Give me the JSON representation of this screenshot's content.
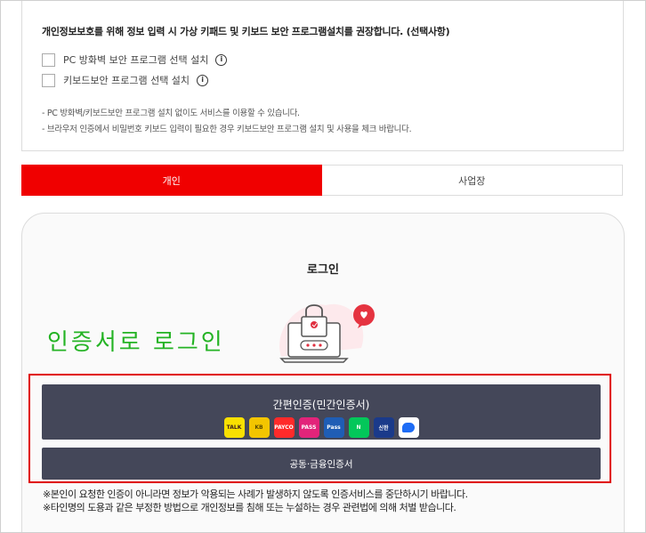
{
  "security": {
    "title": "개인정보보호를 위해 정보 입력 시 가상 키패드 및 키보드 보안 프로그램설치를 권장합니다. (선택사항)",
    "option1": "PC 방화벽 보안 프로그램 선택 설치",
    "option2": "키보드보안 프로그램 선택 설치",
    "info_glyph": "i",
    "note1": "- PC 방화벽/키보드보안 프로그램 설치 없이도 서비스를 이용할 수 있습니다.",
    "note2": "- 브라우저 인증에서 비밀번호 키보드 입력이 필요한 경우 키보드보안 프로그램 설치 및 사용을 체크 바랍니다."
  },
  "tabs": {
    "personal": "개인",
    "business": "사업장"
  },
  "login": {
    "title": "로그인",
    "annotation": "인증서로 로그인",
    "easy_auth_label": "간편인증(민간인증서)",
    "cert_label": "공동·금융인증서"
  },
  "providers": [
    {
      "name": "kakaotalk-icon",
      "text": "TALK",
      "bg": "#f9e000",
      "fg": "#3a1d1d"
    },
    {
      "name": "kb-icon",
      "text": "KB",
      "bg": "#f3c500",
      "fg": "#5b4a00"
    },
    {
      "name": "payco-icon",
      "text": "PAYCO",
      "bg": "#ff2a2a",
      "fg": "#ffffff"
    },
    {
      "name": "pass-icon",
      "text": "PASS",
      "bg": "#e2247a",
      "fg": "#ffffff"
    },
    {
      "name": "samsung-pass-icon",
      "text": "Pass",
      "bg": "#1f5db5",
      "fg": "#ffffff"
    },
    {
      "name": "naver-icon",
      "text": "N",
      "bg": "#03c75a",
      "fg": "#ffffff"
    },
    {
      "name": "shinhan-icon",
      "text": "신한",
      "bg": "#1a3a8a",
      "fg": "#ffffff"
    },
    {
      "name": "toss-icon",
      "text": "",
      "bg": "#ffffff",
      "fg": "#1e6cf5"
    }
  ],
  "disclaimers": {
    "line1": "※본인이 요청한 인증이 아니라면 정보가 악용되는 사례가 발생하지 않도록 인증서비스를 중단하시기 바랍니다.",
    "line2": "※타인명의 도용과 같은 부정한 방법으로 개인정보를 침해 또는 누설하는 경우 관련법에 의해 처벌 받습니다."
  },
  "colors": {
    "accent_red": "#f00000",
    "button_dark": "#444759",
    "annotation_green": "#24b324"
  }
}
